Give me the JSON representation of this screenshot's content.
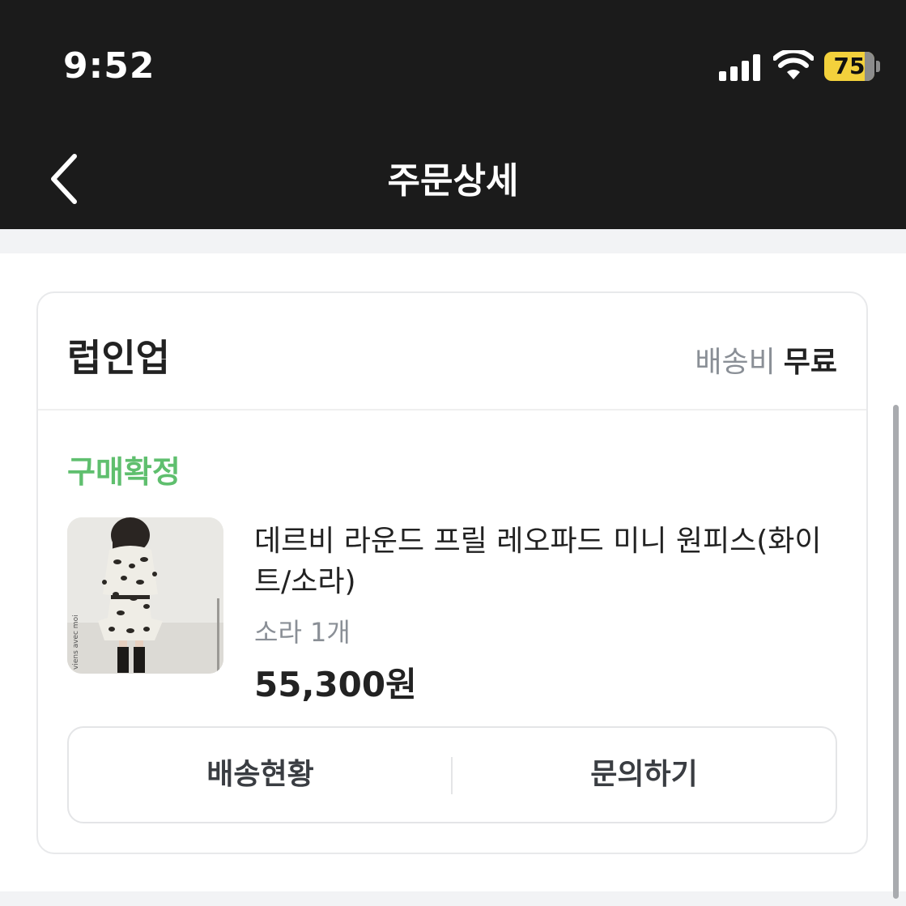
{
  "status_bar": {
    "time": "9:52",
    "battery": "75"
  },
  "nav": {
    "title": "주문상세"
  },
  "order": {
    "seller": "럽인업",
    "shipping_label": "배송비",
    "shipping_value": "무료",
    "status": "구매확정",
    "product": {
      "name": "데르비 라운드 프릴 레오파드 미니 원피스(화이트/소라)",
      "option": "소라 1개",
      "price": "55,300원",
      "image_caption": "viens avec moi"
    },
    "actions": {
      "track_label": "배송현황",
      "inquiry_label": "문의하기"
    }
  },
  "colors": {
    "header_bg": "#1b1b1b",
    "status_green": "#5fbf6e",
    "battery_yellow": "#f3d13c"
  }
}
